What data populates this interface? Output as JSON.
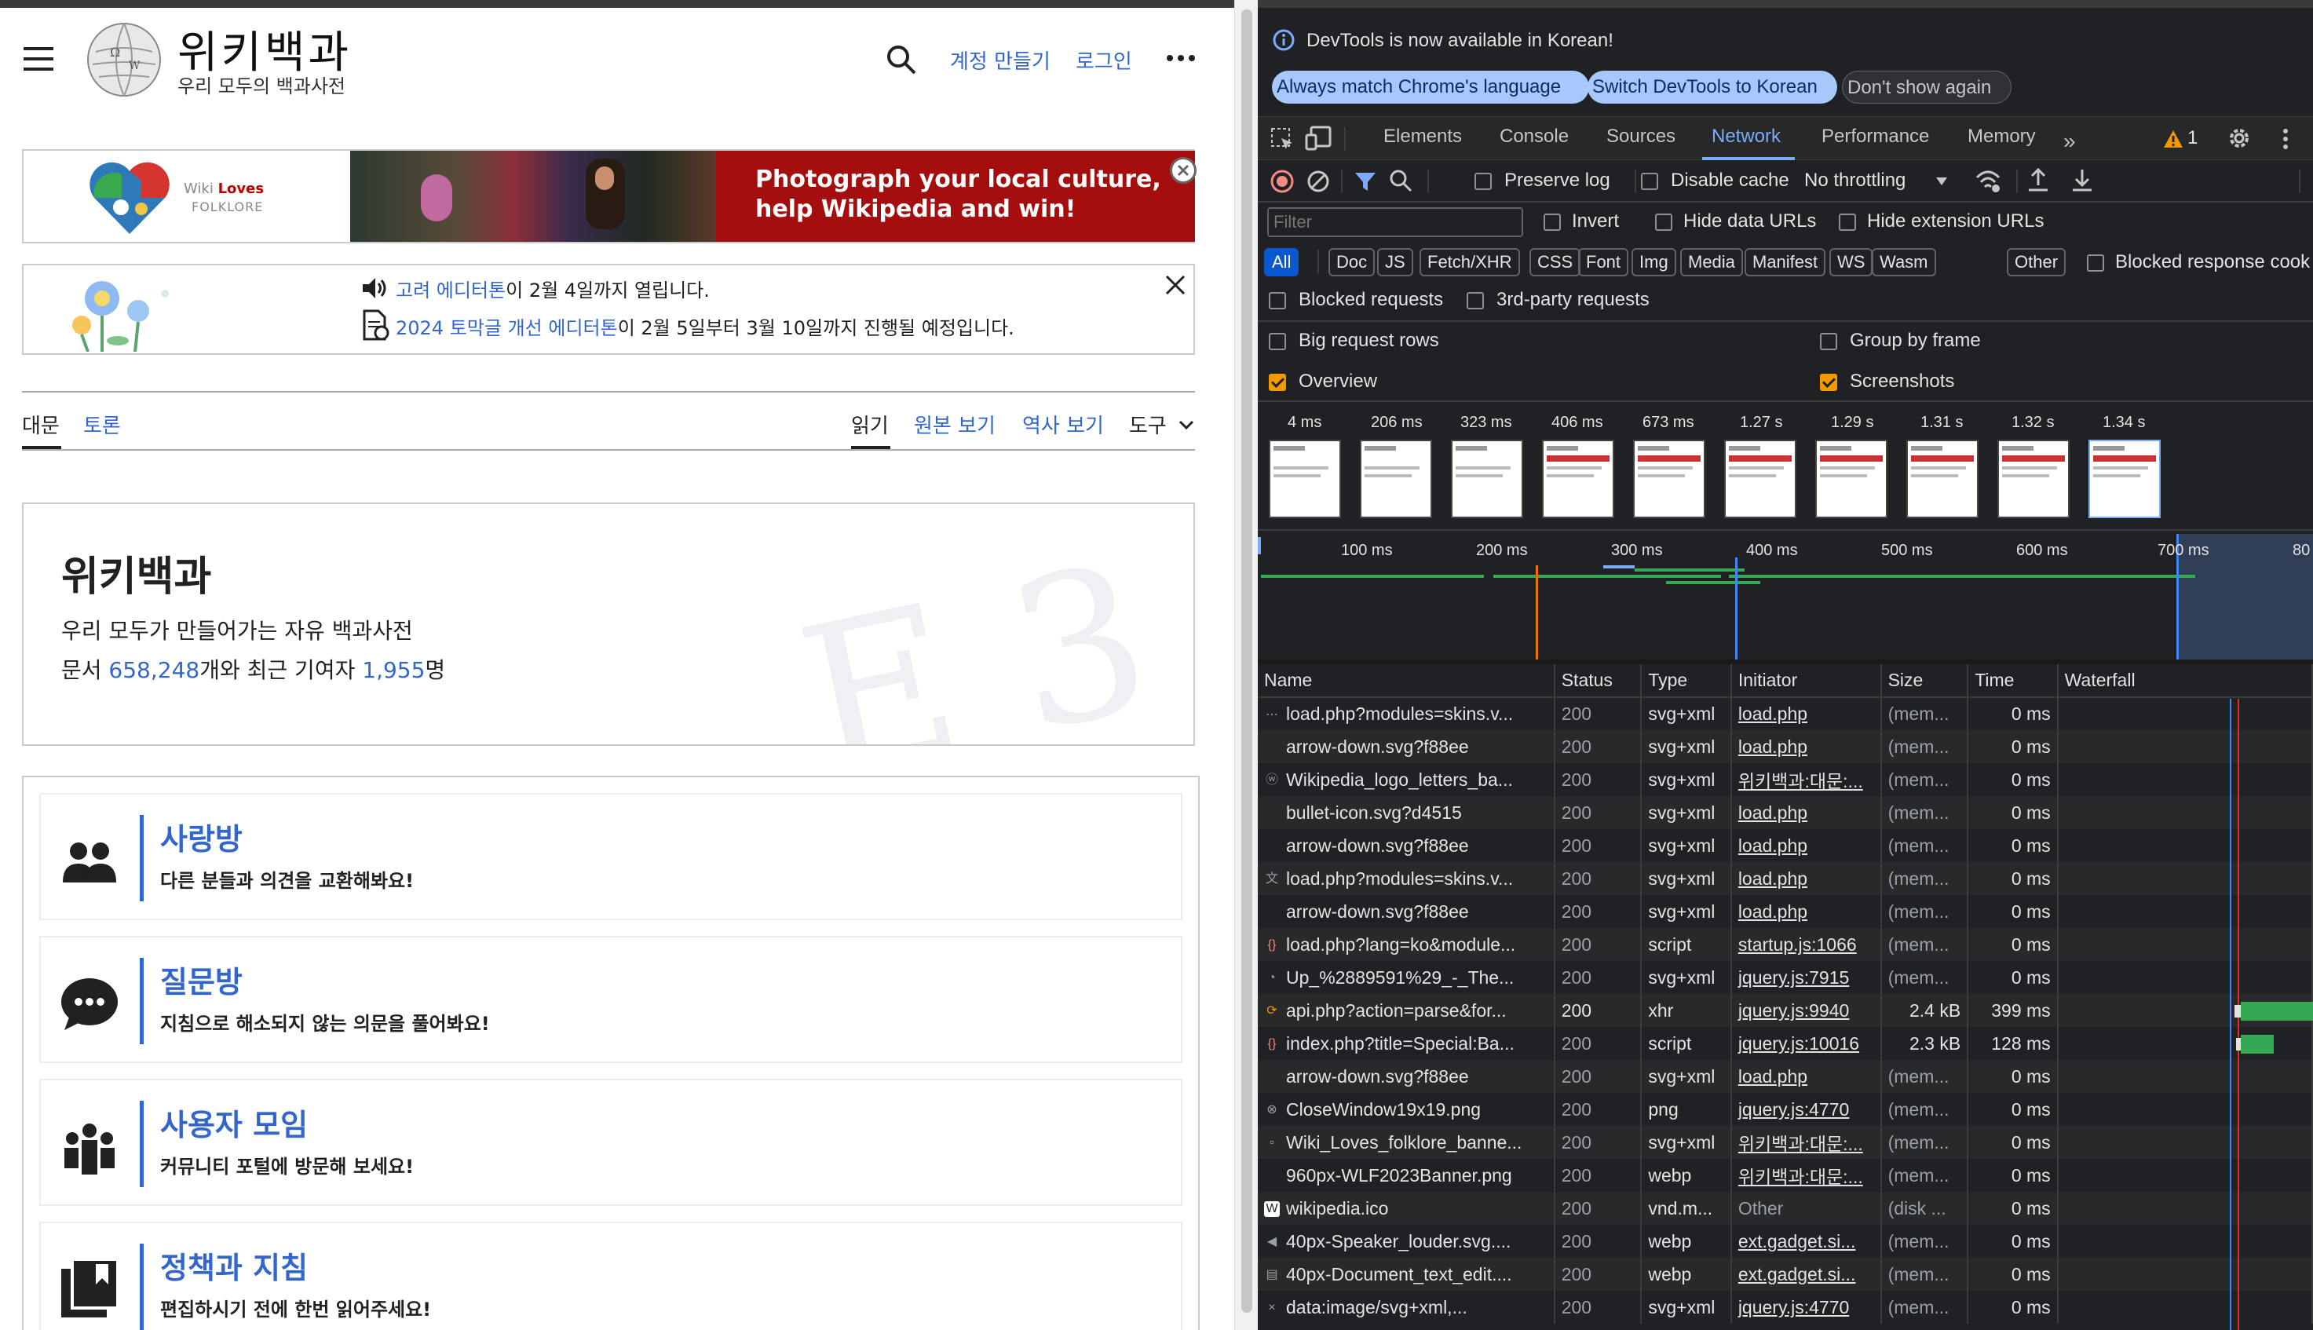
{
  "wiki": {
    "logo_title": "위키백과",
    "logo_tagline": "우리 모두의 백과사전",
    "header_links": {
      "create_account": "계정 만들기",
      "login": "로그인"
    },
    "banner": {
      "brand_line1": "Wiki ",
      "brand_loves": "Loves",
      "brand_line2": "FOLKLORE",
      "headline": "Photograph your local culture, help Wikipedia and win!"
    },
    "notices": [
      {
        "link": "고려 에디터톤",
        "text": "이 2월 4일까지 열립니다."
      },
      {
        "link": "2024 토막글 개선 에디터톤",
        "text": "이 2월 5일부터 3월 10일까지 진행될 예정입니다."
      }
    ],
    "tabs": {
      "main": "대문",
      "talk": "토론",
      "read": "읽기",
      "view_source": "원본 보기",
      "history": "역사 보기",
      "tools": "도구"
    },
    "hero": {
      "title": "위키백과",
      "subtitle": "우리 모두가 만들어가는 자유 백과사전",
      "stats_prefix": "문서 ",
      "articles": "658,248",
      "stats_middle": "개와 최근 기여자 ",
      "contributors": "1,955",
      "stats_suffix": "명"
    },
    "community": [
      {
        "title": "사랑방",
        "desc": "다른 분들과 의견을 교환해봐요!",
        "icon": "people-icon"
      },
      {
        "title": "질문방",
        "desc": "지침으로 해소되지 않는 의문을 풀어봐요!",
        "icon": "speech-bubble-icon"
      },
      {
        "title": "사용자 모임",
        "desc": "커뮤니티 포털에 방문해 보세요!",
        "icon": "user-group-icon"
      },
      {
        "title": "정책과 지침",
        "desc": "편집하시기 전에 한번 읽어주세요!",
        "icon": "book-icon"
      }
    ]
  },
  "devtools": {
    "info": "DevTools is now available in Korean!",
    "info_buttons": [
      "Always match Chrome's language",
      "Switch DevTools to Korean",
      "Don't show again"
    ],
    "tabs": [
      "Elements",
      "Console",
      "Sources",
      "Network",
      "Performance",
      "Memory"
    ],
    "active_tab": "Network",
    "warning_count": "1",
    "toolbar": {
      "preserve_log": "Preserve log",
      "disable_cache": "Disable cache",
      "throttling": "No throttling"
    },
    "filter": {
      "placeholder": "Filter",
      "invert": "Invert",
      "hide_data_urls": "Hide data URLs",
      "hide_extension_urls": "Hide extension URLs"
    },
    "type_filters": [
      "All",
      "Doc",
      "JS",
      "Fetch/XHR",
      "CSS",
      "Font",
      "Img",
      "Media",
      "Manifest",
      "WS",
      "Wasm",
      "Other"
    ],
    "blocked_response_cookies": "Blocked response cook",
    "options": {
      "blocked_requests": "Blocked requests",
      "third_party": "3rd-party requests",
      "big_rows": "Big request rows",
      "group_by_frame": "Group by frame",
      "overview": "Overview",
      "screenshots": "Screenshots",
      "overview_checked": true,
      "screenshots_checked": true
    },
    "screenshot_times": [
      "4 ms",
      "206 ms",
      "323 ms",
      "406 ms",
      "673 ms",
      "1.27 s",
      "1.29 s",
      "1.31 s",
      "1.32 s",
      "1.34 s"
    ],
    "ruler": [
      "100 ms",
      "200 ms",
      "300 ms",
      "400 ms",
      "500 ms",
      "600 ms",
      "700 ms",
      "80"
    ],
    "columns": [
      "Name",
      "Status",
      "Type",
      "Initiator",
      "Size",
      "Time",
      "Waterfall"
    ],
    "requests": [
      {
        "name": "load.php?modules=skins.v...",
        "status": "200",
        "type": "svg+xml",
        "initiator": "load.php",
        "size": "(mem...",
        "time": "0 ms",
        "icon": "dots-icon"
      },
      {
        "name": "arrow-down.svg?f88ee",
        "status": "200",
        "type": "svg+xml",
        "initiator": "load.php",
        "size": "(mem...",
        "time": "0 ms",
        "icon": "blank-icon"
      },
      {
        "name": "Wikipedia_logo_letters_ba...",
        "status": "200",
        "type": "svg+xml",
        "initiator": "위키백과:대문:...",
        "size": "(mem...",
        "time": "0 ms",
        "icon": "wiki-letters-icon"
      },
      {
        "name": "bullet-icon.svg?d4515",
        "status": "200",
        "type": "svg+xml",
        "initiator": "load.php",
        "size": "(mem...",
        "time": "0 ms",
        "icon": "blank-icon"
      },
      {
        "name": "arrow-down.svg?f88ee",
        "status": "200",
        "type": "svg+xml",
        "initiator": "load.php",
        "size": "(mem...",
        "time": "0 ms",
        "icon": "blank-icon"
      },
      {
        "name": "load.php?modules=skins.v...",
        "status": "200",
        "type": "svg+xml",
        "initiator": "load.php",
        "size": "(mem...",
        "time": "0 ms",
        "icon": "translate-icon"
      },
      {
        "name": "arrow-down.svg?f88ee",
        "status": "200",
        "type": "svg+xml",
        "initiator": "load.php",
        "size": "(mem...",
        "time": "0 ms",
        "icon": "blank-icon"
      },
      {
        "name": "load.php?lang=ko&module...",
        "status": "200",
        "type": "script",
        "initiator": "startup.js:1066",
        "size": "(mem...",
        "time": "0 ms",
        "icon": "script-icon"
      },
      {
        "name": "Up_%2889591%29_-_The...",
        "status": "200",
        "type": "svg+xml",
        "initiator": "jquery.js:7915",
        "size": "(mem...",
        "time": "0 ms",
        "icon": "globe-icon"
      },
      {
        "name": "api.php?action=parse&for...",
        "status": "200",
        "type": "xhr",
        "initiator": "jquery.js:9940",
        "size": "2.4 kB",
        "time": "399 ms",
        "icon": "xhr-icon"
      },
      {
        "name": "index.php?title=Special:Ba...",
        "status": "200",
        "type": "script",
        "initiator": "jquery.js:10016",
        "size": "2.3 kB",
        "time": "128 ms",
        "icon": "script-icon"
      },
      {
        "name": "arrow-down.svg?f88ee",
        "status": "200",
        "type": "svg+xml",
        "initiator": "load.php",
        "size": "(mem...",
        "time": "0 ms",
        "icon": "blank-icon"
      },
      {
        "name": "CloseWindow19x19.png",
        "status": "200",
        "type": "png",
        "initiator": "jquery.js:4770",
        "size": "(mem...",
        "time": "0 ms",
        "icon": "close-circle-icon"
      },
      {
        "name": "Wiki_Loves_folklore_banne...",
        "status": "200",
        "type": "svg+xml",
        "initiator": "위키백과:대문:...",
        "size": "(mem...",
        "time": "0 ms",
        "icon": "image-icon"
      },
      {
        "name": "960px-WLF2023Banner.png",
        "status": "200",
        "type": "webp",
        "initiator": "위키백과:대문:...",
        "size": "(mem...",
        "time": "0 ms",
        "icon": "blank-icon"
      },
      {
        "name": "wikipedia.ico",
        "status": "200",
        "type": "vnd.m...",
        "initiator": "Other",
        "size": "(disk ...",
        "time": "0 ms",
        "icon": "wikipedia-icon"
      },
      {
        "name": "40px-Speaker_louder.svg....",
        "status": "200",
        "type": "webp",
        "initiator": "ext.gadget.si...",
        "size": "(mem...",
        "time": "0 ms",
        "icon": "speaker-icon"
      },
      {
        "name": "40px-Document_text_edit....",
        "status": "200",
        "type": "webp",
        "initiator": "ext.gadget.si...",
        "size": "(mem...",
        "time": "0 ms",
        "icon": "document-icon"
      },
      {
        "name": "data:image/svg+xml,...",
        "status": "200",
        "type": "svg+xml",
        "initiator": "jquery.js:4770",
        "size": "(mem...",
        "time": "0 ms",
        "icon": "x-icon"
      }
    ]
  }
}
